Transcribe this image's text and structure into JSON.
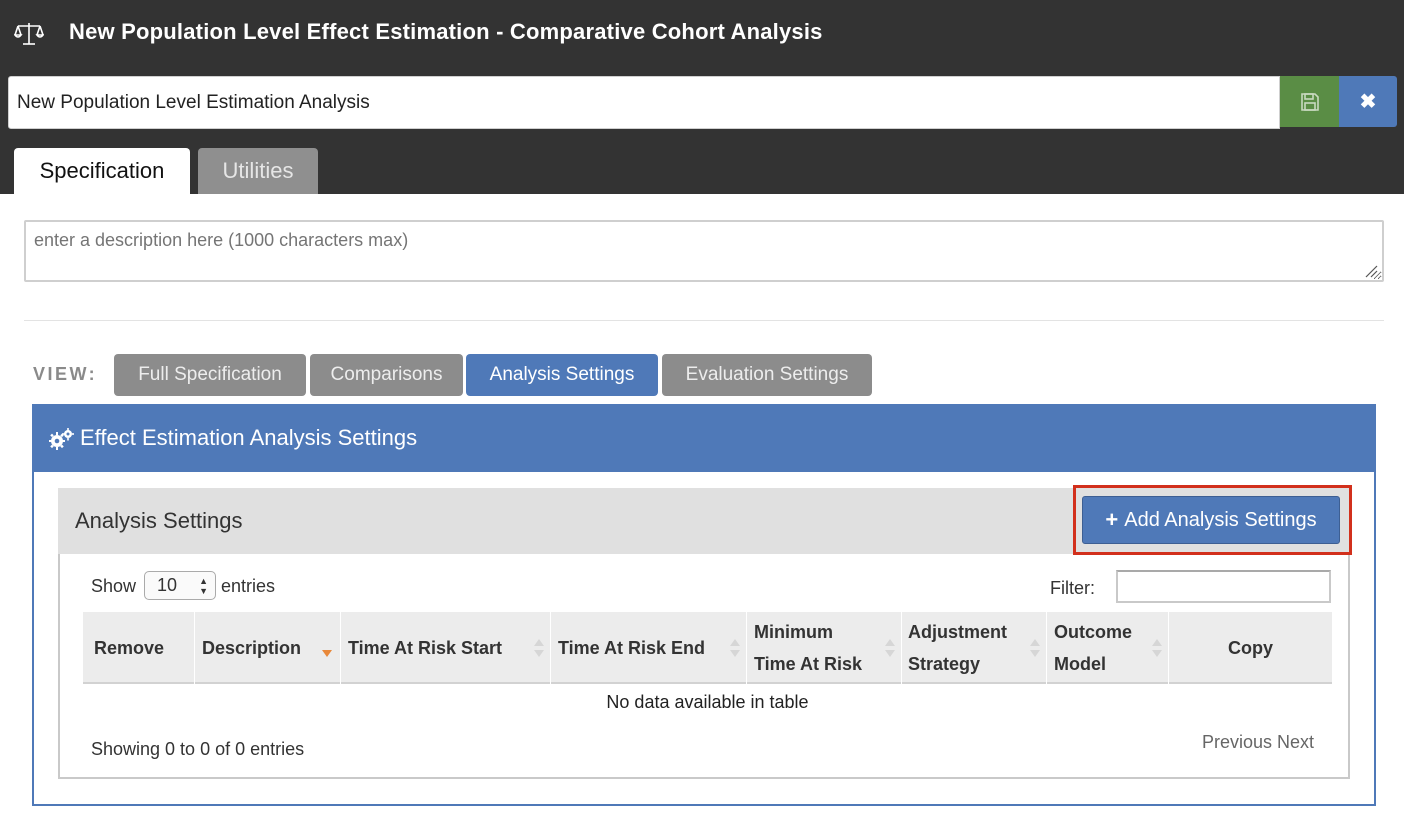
{
  "header": {
    "title": "New Population Level Effect Estimation - Comparative Cohort Analysis",
    "icon": "balance-scale-icon"
  },
  "analysis_name": {
    "value": "New Population Level Estimation Analysis",
    "save_icon": "save-icon",
    "close_icon": "close-icon",
    "close_glyph": "✖"
  },
  "tabs": [
    {
      "label": "Specification",
      "active": true
    },
    {
      "label": "Utilities",
      "active": false
    }
  ],
  "description": {
    "placeholder": "enter a description here (1000 characters max)",
    "value": ""
  },
  "view": {
    "label": "VIEW:",
    "buttons": [
      {
        "label": "Full Specification",
        "active": false
      },
      {
        "label": "Comparisons",
        "active": false
      },
      {
        "label": "Analysis Settings",
        "active": true
      },
      {
        "label": "Evaluation Settings",
        "active": false
      }
    ]
  },
  "panel": {
    "title": "Effect Estimation Analysis Settings",
    "icon": "cogs-icon"
  },
  "analysis_settings": {
    "title": "Analysis Settings",
    "add_button": {
      "plus": "+",
      "label": "Add Analysis Settings"
    },
    "show_label": "Show",
    "page_length": "10",
    "entries_label": "entries",
    "filter_label": "Filter:",
    "filter_value": "",
    "columns": [
      {
        "line1": "Remove",
        "line2": ""
      },
      {
        "line1": "Description",
        "line2": ""
      },
      {
        "line1": "Time At Risk Start",
        "line2": ""
      },
      {
        "line1": "Time At Risk End",
        "line2": ""
      },
      {
        "line1": "Minimum",
        "line2": "Time At Risk"
      },
      {
        "line1": "Adjustment",
        "line2": "Strategy"
      },
      {
        "line1": "Outcome",
        "line2": "Model"
      },
      {
        "line1": "Copy",
        "line2": ""
      }
    ],
    "empty_message": "No data available in table",
    "info": "Showing 0 to 0 of 0 entries",
    "previous": "Previous",
    "next": "Next"
  },
  "colors": {
    "header_bg": "#333333",
    "primary_blue": "#4f79b8",
    "save_green": "#5a8d45",
    "inactive_gray": "#8c8c8c",
    "highlight_red": "#d2301c",
    "sort_active_orange": "#e8883a"
  }
}
